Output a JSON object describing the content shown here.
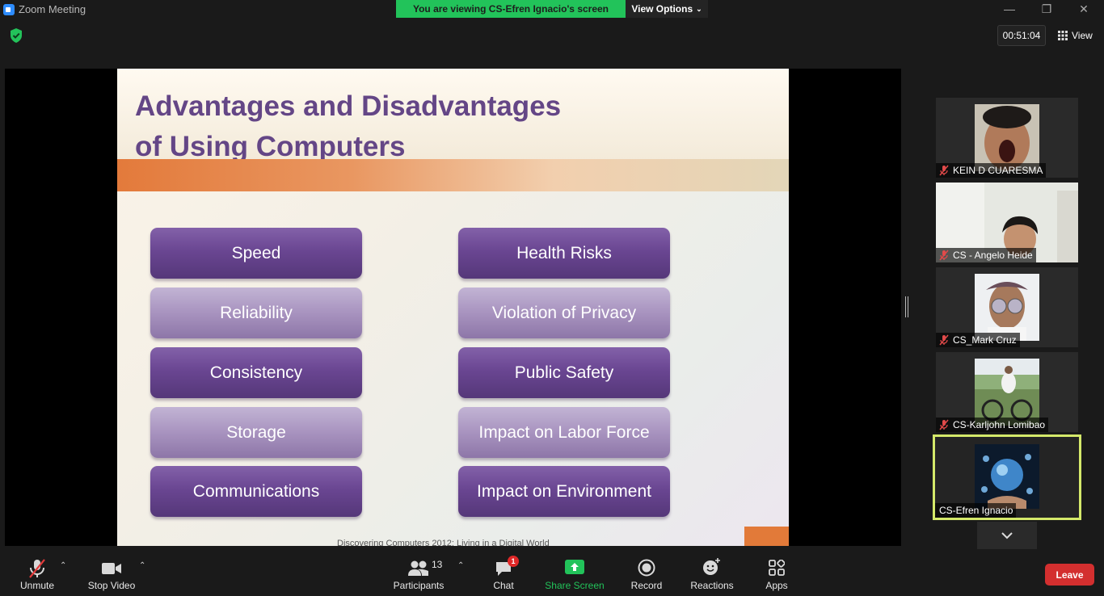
{
  "window": {
    "app_title": "Zoom Meeting",
    "viewing_banner": "You are viewing CS-Efren Ignacio's screen",
    "view_options": "View Options",
    "timer": "00:51:04",
    "view_label": "View"
  },
  "slide": {
    "title_line1": "Advantages and Disadvantages",
    "title_line2": "of Using Computers",
    "advantages": [
      "Speed",
      "Reliability",
      "Consistency",
      "Storage",
      "Communications"
    ],
    "disadvantages": [
      "Health Risks",
      "Violation of Privacy",
      "Public Safety",
      "Impact on Labor Force",
      "Impact on Environment"
    ],
    "footer": "Discovering Computers 2012: Living in a Digital World"
  },
  "participants": [
    {
      "name": "KEIN D  CUARESMA",
      "muted": true
    },
    {
      "name": "CS - Angelo Heide",
      "muted": true
    },
    {
      "name": "CS_Mark Cruz",
      "muted": true
    },
    {
      "name": "CS-Karljohn Lomibao",
      "muted": true
    },
    {
      "name": "CS-Efren Ignacio",
      "muted": false,
      "active_speaker": true
    }
  ],
  "toolbar": {
    "unmute": "Unmute",
    "stop_video": "Stop Video",
    "participants": "Participants",
    "participant_count": "13",
    "chat": "Chat",
    "chat_badge": "1",
    "share_screen": "Share Screen",
    "record": "Record",
    "reactions": "Reactions",
    "apps": "Apps",
    "leave": "Leave"
  },
  "colors": {
    "banner_green": "#22c35a",
    "slide_purple": "#644686",
    "active_border": "#d4e96a",
    "leave_red": "#d32f2f",
    "share_green": "#22c35a"
  }
}
